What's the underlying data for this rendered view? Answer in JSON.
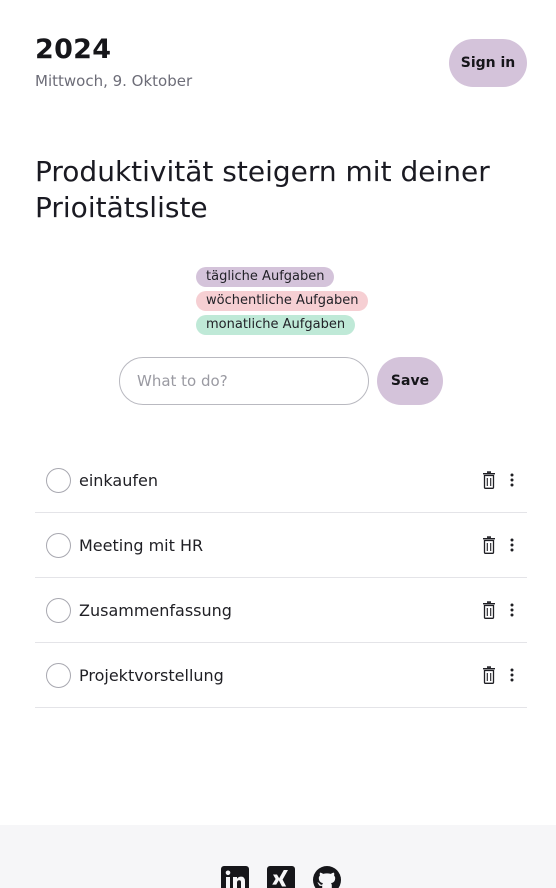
{
  "header": {
    "year": "2024",
    "date": "Mittwoch, 9. Oktober",
    "sign_in_label": "Sign in"
  },
  "headline": "Produktivität steigern mit deiner Prioitätsliste",
  "tags": [
    {
      "label": "tägliche Aufgaben",
      "color": "#d4c3da"
    },
    {
      "label": "wöchentliche Aufgaben",
      "color": "#f6cfd3"
    },
    {
      "label": "monatliche Aufgaben",
      "color": "#bfe9d7"
    }
  ],
  "input": {
    "placeholder": "What to do?",
    "value": ""
  },
  "save_label": "Save",
  "tasks": [
    {
      "label": "einkaufen"
    },
    {
      "label": "Meeting mit HR"
    },
    {
      "label": "Zusammenfassung"
    },
    {
      "label": "Projektvorstellung"
    }
  ],
  "footer": {
    "icons": [
      "linkedin-icon",
      "xing-icon",
      "github-icon"
    ]
  },
  "colors": {
    "accent": "#d4c3da",
    "footer_bg": "#f6f6f8",
    "divider": "#e4e4e8"
  }
}
